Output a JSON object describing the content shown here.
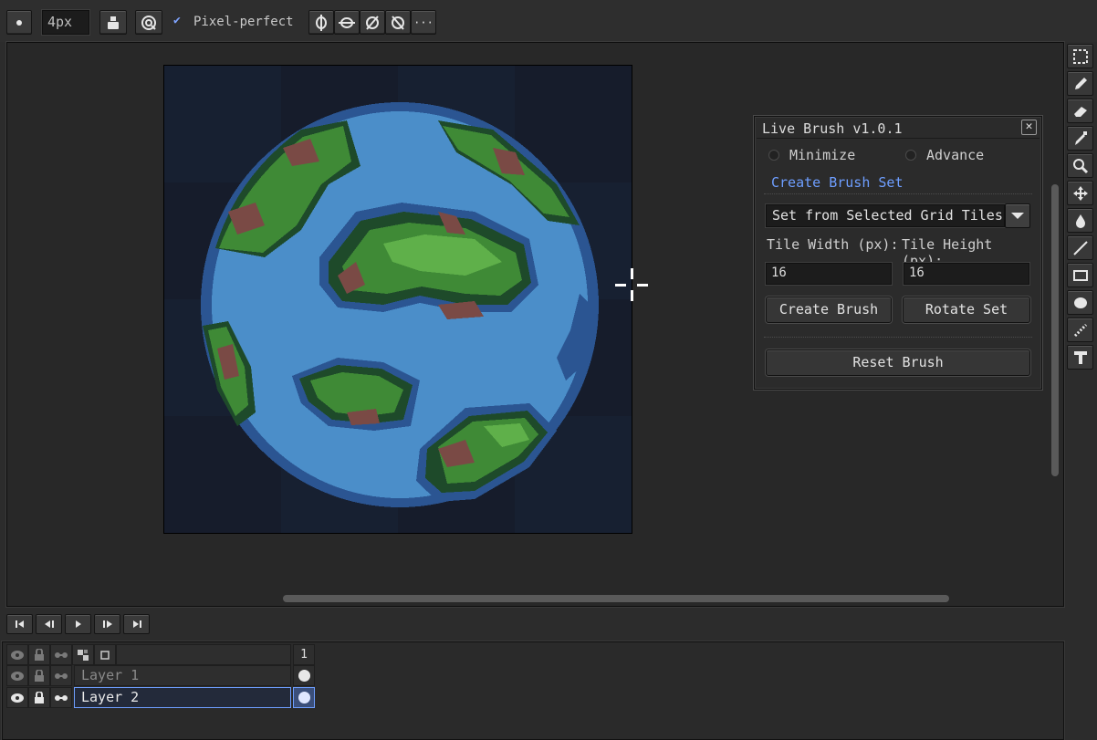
{
  "toolbar": {
    "brush_size": "4px",
    "pixel_perfect_label": "Pixel-perfect",
    "pixel_perfect_checked": true,
    "more_label": "···"
  },
  "live_brush": {
    "title": "Live Brush v1.0.1",
    "close_label": "✕",
    "minimize_label": "Minimize",
    "advance_label": "Advance",
    "section_label": "Create Brush Set",
    "mode_value": "Set from Selected Grid Tiles",
    "tile_width_label": "Tile Width (px):",
    "tile_height_label": "Tile Height (px):",
    "tile_width_value": "16",
    "tile_height_value": "16",
    "create_brush_label": "Create Brush",
    "rotate_set_label": "Rotate Set",
    "reset_brush_label": "Reset Brush"
  },
  "timeline": {
    "frame_header": "1",
    "layers": [
      {
        "name": "Layer 1",
        "selected": false
      },
      {
        "name": "Layer 2",
        "selected": true
      }
    ]
  },
  "colors": {
    "accent": "#6e9eff",
    "sprite_bg": "#161c2b",
    "water": "#4b8ec9",
    "land": "#3f8a36"
  },
  "icons": {
    "tools": [
      "marquee-icon",
      "pencil-icon",
      "eraser-icon",
      "eyedropper-icon",
      "zoom-icon",
      "move-icon",
      "fill-icon",
      "line-icon",
      "rectangle-icon",
      "ellipse-icon",
      "contour-icon",
      "text-icon"
    ]
  }
}
